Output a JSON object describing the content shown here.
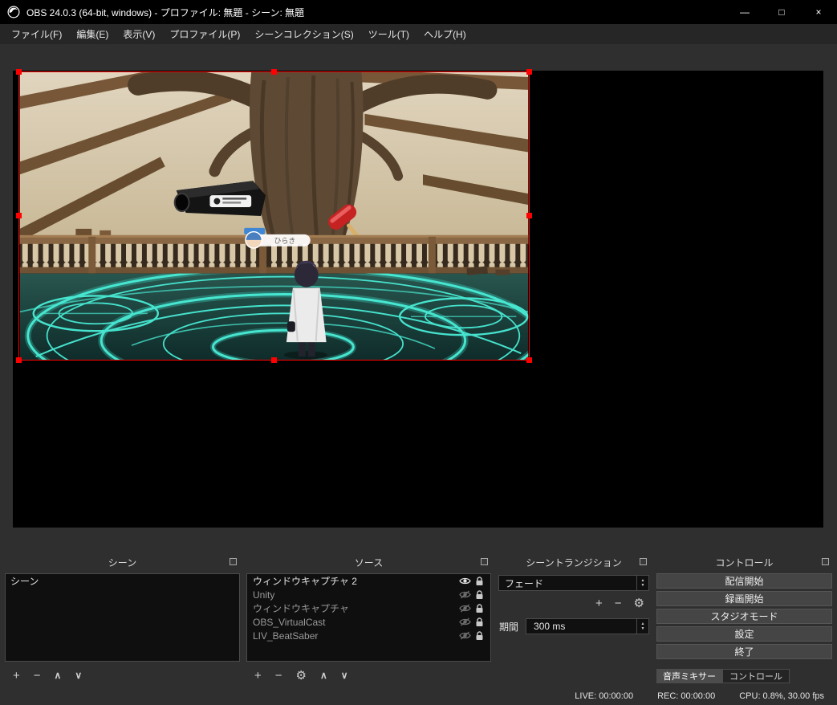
{
  "window": {
    "title": "OBS 24.0.3 (64-bit, windows) - プロファイル: 無題 - シーン: 無題"
  },
  "icons": {
    "minimize": "—",
    "maximize": "□",
    "close": "×",
    "plus": "+",
    "minus": "−",
    "gear": "⚙",
    "up": "∧",
    "down": "∨",
    "spin_up": "▲",
    "spin_down": "▼"
  },
  "menu": {
    "items": [
      {
        "label": "ファイル(F)"
      },
      {
        "label": "編集(E)"
      },
      {
        "label": "表示(V)"
      },
      {
        "label": "プロファイル(P)"
      },
      {
        "label": "シーンコレクション(S)"
      },
      {
        "label": "ツール(T)"
      },
      {
        "label": "ヘルプ(H)"
      }
    ]
  },
  "preview": {
    "nametag": "ひらき"
  },
  "scenes": {
    "title": "シーン",
    "items": [
      {
        "name": "シーン"
      }
    ]
  },
  "sources": {
    "title": "ソース",
    "items": [
      {
        "name": "ウィンドウキャプチャ 2",
        "visible": true,
        "locked": true
      },
      {
        "name": "Unity",
        "visible": false,
        "locked": true
      },
      {
        "name": "ウィンドウキャプチャ",
        "visible": false,
        "locked": true
      },
      {
        "name": "OBS_VirtualCast",
        "visible": false,
        "locked": true
      },
      {
        "name": "LIV_BeatSaber",
        "visible": false,
        "locked": true
      }
    ]
  },
  "transitions": {
    "title": "シーントランジション",
    "selected": "フェード",
    "duration_label": "期間",
    "duration_value": "300 ms"
  },
  "controls": {
    "title": "コントロール",
    "buttons": [
      {
        "label": "配信開始"
      },
      {
        "label": "録画開始"
      },
      {
        "label": "スタジオモード"
      },
      {
        "label": "設定"
      },
      {
        "label": "終了"
      }
    ]
  },
  "dock_tabs": [
    {
      "label": "音声ミキサー"
    },
    {
      "label": "コントロール"
    }
  ],
  "statusbar": {
    "live": "LIVE: 00:00:00",
    "rec": "REC: 00:00:00",
    "cpu": "CPU: 0.8%, 30.00 fps"
  },
  "colors": {
    "selection_red": "#ff0000",
    "magic_cyan": "#3fe0cc"
  }
}
